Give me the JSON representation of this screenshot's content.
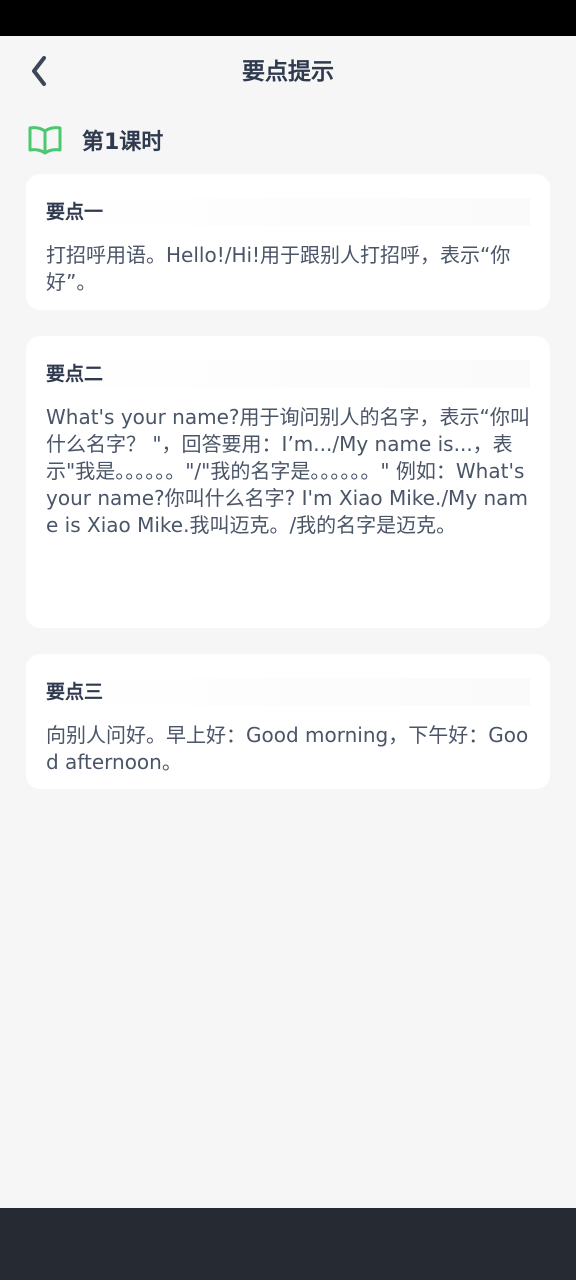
{
  "header": {
    "title": "要点提示",
    "back_icon": "chevron-left-icon"
  },
  "lesson": {
    "icon": "open-book-icon",
    "title": "第1课时",
    "icon_color": "#4cc870"
  },
  "points": [
    {
      "title": "要点一",
      "body": "打招呼用语。Hello!/Hi!用于跟别人打招呼，表示“你好”。"
    },
    {
      "title": "要点二",
      "body": "What's your name?用于询问别人的名字，表示“你叫什么名字？ \"，回答要用：I’m.../My name is...，表示\"我是。。。。。。\"/\"我的名字是。。。。。。\" 例如：What's your name?你叫什么名字? I'm Xiao Mike./My name is Xiao Mike.我叫迈克。/我的名字是迈克。"
    },
    {
      "title": "要点三",
      "body": "向别人问好。早上好：Good morning，下午好：Good afternoon。"
    }
  ],
  "colors": {
    "status_bar": "#000000",
    "background": "#f6f6f6",
    "card": "#ffffff",
    "text_dark": "#2f3a4f",
    "nav_bar": "#262a33"
  }
}
